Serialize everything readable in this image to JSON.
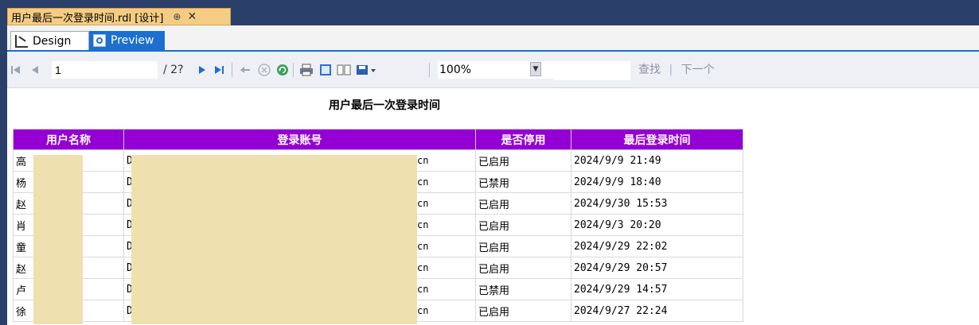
{
  "document_tab": {
    "title": "用户最后一次登录时间.rdl [设计]",
    "pin": "⊕",
    "close": "✕"
  },
  "view_tabs": {
    "design": "Design",
    "preview": "Preview"
  },
  "toolbar": {
    "page_current": "1",
    "page_of": "/ 2?",
    "zoom": "100%",
    "find_label": "查找",
    "find_sep": "|",
    "find_next_label": "下一个"
  },
  "report": {
    "title": "用户最后一次登录时间",
    "columns": [
      "用户名称",
      "登录账号",
      "是否停用",
      "最后登录时间"
    ],
    "rows": [
      {
        "name": "高",
        "account_prefix": "D",
        "account_suffix": "cn",
        "status": "已启用",
        "last_login": "2024/9/9 21:49"
      },
      {
        "name": "杨",
        "account_prefix": "D",
        "account_suffix": "cn",
        "status": "已禁用",
        "last_login": "2024/9/9 18:40"
      },
      {
        "name": "赵",
        "account_prefix": "D",
        "account_suffix": "cn",
        "status": "已启用",
        "last_login": "2024/9/30 15:53"
      },
      {
        "name": "肖",
        "account_prefix": "D",
        "account_suffix": "cn",
        "status": "已启用",
        "last_login": "2024/9/3 20:20"
      },
      {
        "name": "童",
        "account_prefix": "D",
        "account_suffix": "cn",
        "status": "已启用",
        "last_login": "2024/9/29 22:02"
      },
      {
        "name": "赵",
        "account_prefix": "D",
        "account_suffix": "cn",
        "status": "已启用",
        "last_login": "2024/9/29 20:57"
      },
      {
        "name": "卢",
        "account_prefix": "D",
        "account_suffix": "cn",
        "status": "已禁用",
        "last_login": "2024/9/29 14:57"
      },
      {
        "name": "徐",
        "account_prefix": "D",
        "account_suffix": "cn",
        "status": "已启用",
        "last_login": "2024/9/27 22:24"
      }
    ]
  },
  "colors": {
    "header_bg": "#9400d3",
    "redaction": "#efe0b0",
    "ide_frame": "#2b3f6b",
    "doc_tab": "#f5cc84",
    "preview_tab": "#1c6fcf"
  }
}
